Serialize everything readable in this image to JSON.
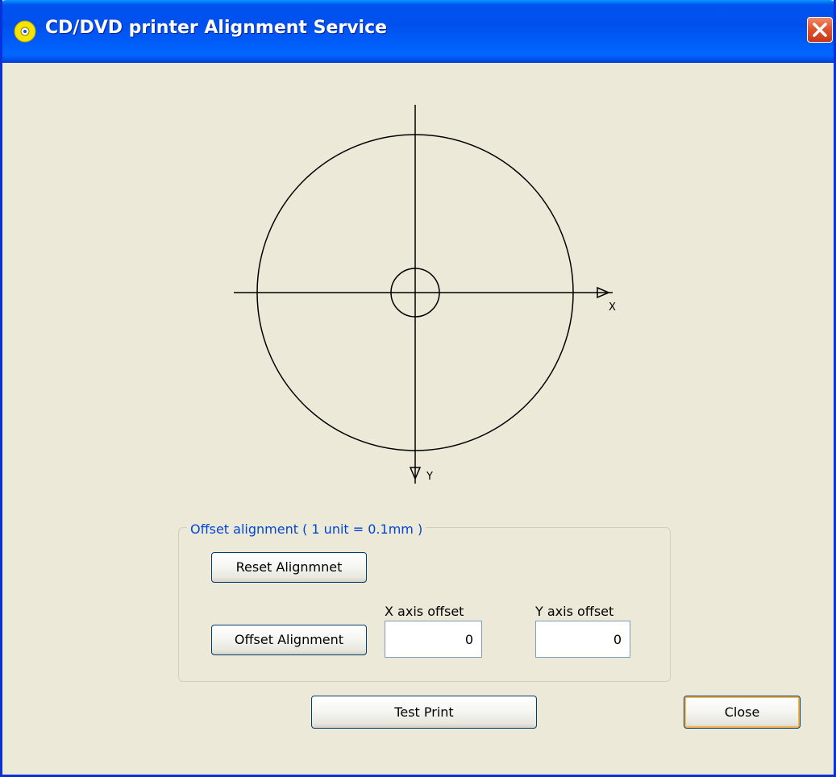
{
  "window": {
    "title": "CD/DVD printer Alignment Service",
    "icon": "cd-disc-icon",
    "accent_color": "#0050ee",
    "close_button_color": "#e0552f"
  },
  "diagram": {
    "x_axis_label": "X",
    "y_axis_label": "Y"
  },
  "offset_group": {
    "legend": "Offset alignment ( 1 unit = 0.1mm )",
    "reset_button_label": "Reset Alignmnet",
    "offset_button_label": "Offset Alignment",
    "x_offset_label": "X axis offset",
    "y_offset_label": "Y axis offset",
    "x_offset_value": "0",
    "y_offset_value": "0"
  },
  "footer": {
    "test_print_label": "Test Print",
    "close_label": "Close"
  }
}
